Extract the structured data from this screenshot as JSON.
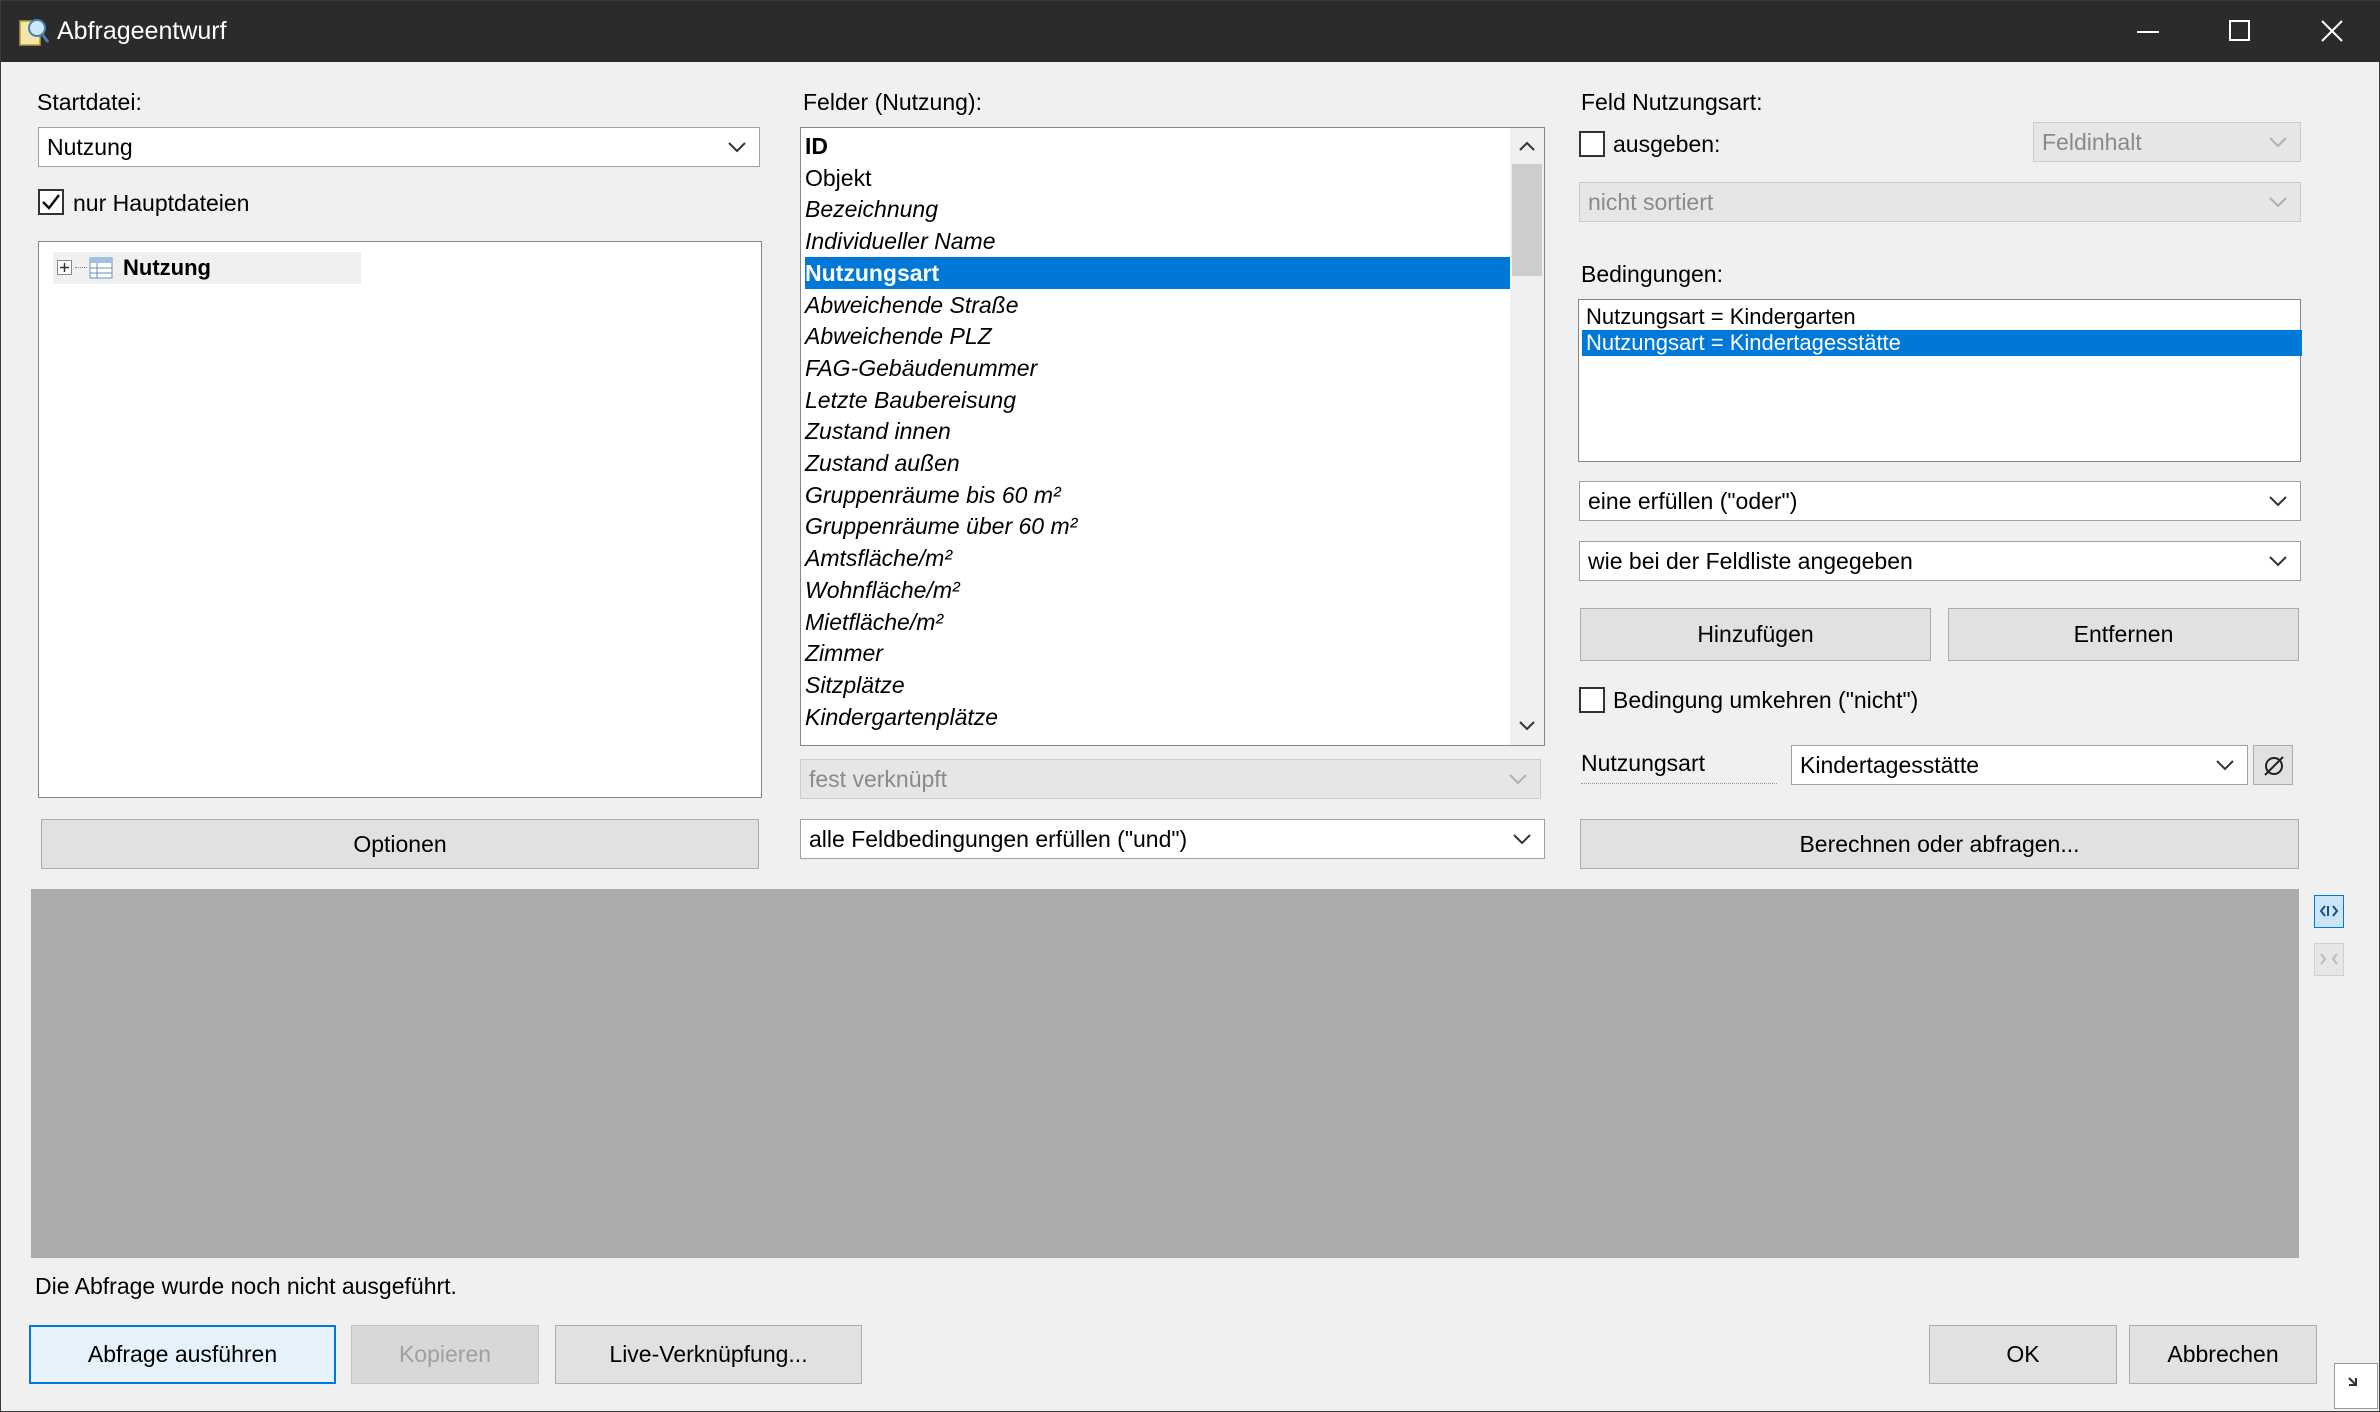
{
  "window": {
    "title": "Abfrageentwurf"
  },
  "left": {
    "startfile_label": "Startdatei:",
    "startfile_value": "Nutzung",
    "only_main_label": "nur Hauptdateien",
    "only_main_checked": true,
    "tree_root": "Nutzung",
    "options_button": "Optionen"
  },
  "fields": {
    "label": "Felder (Nutzung):",
    "items": [
      {
        "text": "ID",
        "style": "bold"
      },
      {
        "text": "Objekt",
        "style": "normal"
      },
      {
        "text": "Bezeichnung",
        "style": "italic"
      },
      {
        "text": "Individueller Name",
        "style": "italic"
      },
      {
        "text": "Nutzungsart",
        "style": "bold-selected"
      },
      {
        "text": "Abweichende Straße",
        "style": "italic"
      },
      {
        "text": "Abweichende PLZ",
        "style": "italic"
      },
      {
        "text": "FAG-Gebäudenummer",
        "style": "italic"
      },
      {
        "text": "Letzte Baubereisung",
        "style": "italic"
      },
      {
        "text": "Zustand innen",
        "style": "italic"
      },
      {
        "text": "Zustand außen",
        "style": "italic"
      },
      {
        "text": "Gruppenräume bis 60 m²",
        "style": "italic"
      },
      {
        "text": "Gruppenräume über 60 m²",
        "style": "italic"
      },
      {
        "text": "Amtsfläche/m²",
        "style": "italic"
      },
      {
        "text": "Wohnfläche/m²",
        "style": "italic"
      },
      {
        "text": "Mietfläche/m²",
        "style": "italic"
      },
      {
        "text": "Zimmer",
        "style": "italic"
      },
      {
        "text": "Sitzplätze",
        "style": "italic"
      },
      {
        "text": "Kindergartenplätze",
        "style": "italic"
      }
    ],
    "link_mode": "fest verknüpft",
    "field_conditions_mode": "alle Feldbedingungen erfüllen (\"und\")"
  },
  "right": {
    "group_label": "Feld Nutzungsart:",
    "output_label": "ausgeben:",
    "output_checked": false,
    "output_mode": "Feldinhalt",
    "sort_mode": "nicht sortiert",
    "conditions_label": "Bedingungen:",
    "conditions": [
      {
        "text": "Nutzungsart = Kindergarten",
        "selected": false
      },
      {
        "text": "Nutzungsart = Kindertagesstätte",
        "selected": true
      }
    ],
    "match_mode": "eine erfüllen (\"oder\")",
    "compare_mode": "wie bei der Feldliste angegeben",
    "add_button": "Hinzufügen",
    "remove_button": "Entfernen",
    "invert_label": "Bedingung umkehren (\"nicht\")",
    "invert_checked": false,
    "value_field_label": "Nutzungsart",
    "value_field_value": "Kindertagesstätte",
    "calc_button": "Berechnen oder abfragen..."
  },
  "bottom": {
    "status_text": "Die Abfrage wurde noch nicht ausgeführt.",
    "run_button": "Abfrage ausführen",
    "copy_button": "Kopieren",
    "live_button": "Live-Verknüpfung...",
    "ok_button": "OK",
    "cancel_button": "Abbrechen"
  },
  "colors": {
    "accent": "#0078d7",
    "titlebar": "#2b2b2b",
    "results_area": "#ababab"
  }
}
